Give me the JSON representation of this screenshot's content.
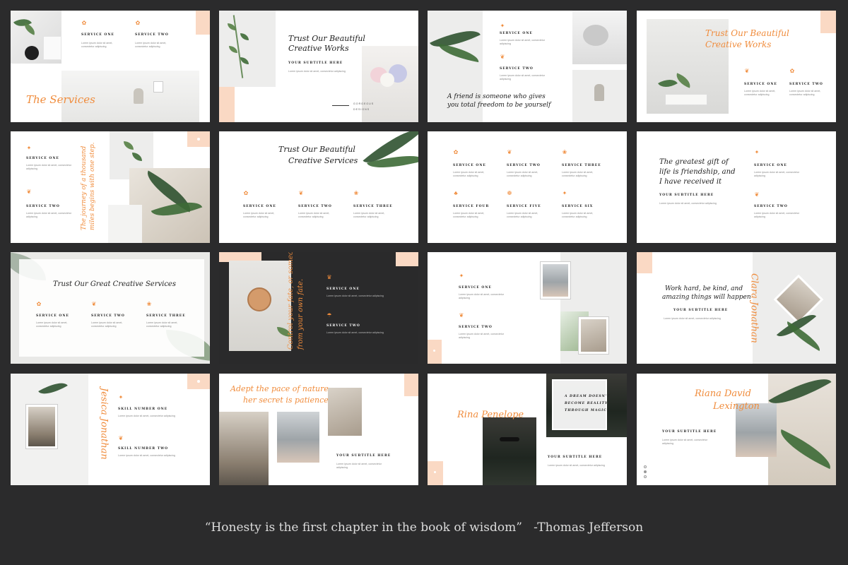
{
  "slides": {
    "s1": {
      "title": "The Services",
      "svc1": "SERVICE ONE",
      "svc2": "SERVICE TWO"
    },
    "s2": {
      "title_l1": "Trust Our Beautiful",
      "title_l2": "Creative Works",
      "subtitle": "YOUR SUBTITLE HERE",
      "tag_l1": "GORGEOUS",
      "tag_l2": "DESIGNS"
    },
    "s3": {
      "svc1": "SERVICE ONE",
      "svc2": "SERVICE TWO",
      "quote_l1": "A friend is someone who gives",
      "quote_l2": "you total freedom to be yourself"
    },
    "s4": {
      "title_l1": "Trust Our Beautiful",
      "title_l2": "Creative Works",
      "svc1": "SERVICE ONE",
      "svc2": "SERVICE TWO"
    },
    "s5": {
      "svc1": "SERVICE ONE",
      "svc2": "SERVICE TWO",
      "vquote_l1": "The journey of a thousand",
      "vquote_l2": "miles begins with one step."
    },
    "s6": {
      "title_l1": "Trust Our Beautiful",
      "title_l2": "Creative Services",
      "svc1": "SERVICE ONE",
      "svc2": "SERVICE TWO",
      "svc3": "SERVICE THREE"
    },
    "s7": {
      "svc1": "SERVICE ONE",
      "svc2": "SERVICE TWO",
      "svc3": "SERVICE THREE",
      "svc4": "SERVICE FOUR",
      "svc5": "SERVICE FIVE",
      "svc6": "SERVICE SIX"
    },
    "s8": {
      "title_l1": "The greatest gift of",
      "title_l2": "life is friendship, and",
      "title_l3": "I have received it",
      "subtitle": "YOUR SUBTITLE HERE",
      "svc1": "SERVICE ONE",
      "svc2": "SERVICE TWO"
    },
    "s9": {
      "title": "Trust Our Great Creative Services",
      "svc1": "SERVICE ONE",
      "svc2": "SERVICE TWO",
      "svc3": "SERVICE THREE"
    },
    "s10": {
      "vquote_l1": "Control your fate, or someone else will.",
      "vquote_l2": "from your own fate.",
      "svc1": "SERVICE ONE",
      "svc2": "SERVICE TWO"
    },
    "s11": {
      "svc1": "SERVICE ONE",
      "svc2": "SERVICE TWO"
    },
    "s12": {
      "title_l1": "Work hard, be kind, and",
      "title_l2": "amazing things will happen",
      "subtitle": "YOUR SUBTITLE HERE",
      "name": "Clara Jonathan"
    },
    "s13": {
      "name": "Jesica Jonathan",
      "skill1": "SKILL NUMBER ONE",
      "skill2": "SKILL NUMBER TWO"
    },
    "s14": {
      "title_l1": "Adept the pace of nature",
      "title_l2": "her secret is patience",
      "subtitle": "YOUR SUBTITLE HERE"
    },
    "s15": {
      "name": "Rina Penelope",
      "quote_l1": "A DREAM DOESN'T",
      "quote_l2": "BECOME REALITY",
      "quote_l3": "THROUGH MAGIC.",
      "subtitle": "YOUR SUBTITLE HERE"
    },
    "s16": {
      "name_l1": "Riana David",
      "name_l2": "Lexington",
      "subtitle": "YOUR SUBTITLE HERE"
    }
  },
  "lorem": {
    "line1": "Lorem ipsum dolor sit amet, consectetur adipiscing",
    "line2": "elit. Vivamus efficitur lobortis tempus. Morbi a est",
    "line3": "efficitur lobortis."
  },
  "footer_quote": {
    "text": "“Honesty is the first chapter in the book of wisdom”",
    "author": "-Thomas Jefferson"
  },
  "colors": {
    "accent": "#f08c3c",
    "peach": "#fad9c4",
    "background": "#2b2b2c"
  }
}
